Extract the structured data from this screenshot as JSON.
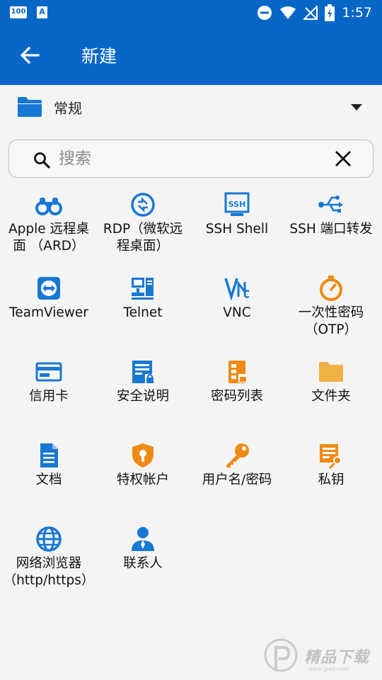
{
  "status_bar": {
    "left_badge_1": "100",
    "left_badge_2": "A",
    "time": "1:57"
  },
  "app_bar": {
    "title": "新建",
    "back_icon": "arrow-left-icon"
  },
  "folder": {
    "label": "常规",
    "icon": "folder-icon"
  },
  "search": {
    "placeholder": "搜索",
    "value": ""
  },
  "items": [
    {
      "label": "Apple 远程桌面 （ARD）",
      "icon": "binoculars-icon",
      "color": "#1778d4"
    },
    {
      "label": "RDP（微软远程桌面）",
      "icon": "remote-desktop-icon",
      "color": "#1778d4"
    },
    {
      "label": "SSH Shell",
      "icon": "ssh-icon",
      "color": "#1778d4"
    },
    {
      "label": "SSH 端口转发",
      "icon": "usb-fork-icon",
      "color": "#1778d4"
    },
    {
      "label": "TeamViewer",
      "icon": "teamviewer-icon",
      "color": "#1778d4"
    },
    {
      "label": "Telnet",
      "icon": "telnet-icon",
      "color": "#1778d4"
    },
    {
      "label": "VNC",
      "icon": "vnc-icon",
      "color": "#1778d4"
    },
    {
      "label": "一次性密码（OTP）",
      "icon": "stopwatch-icon",
      "color": "#ef8a14"
    },
    {
      "label": "信用卡",
      "icon": "credit-card-icon",
      "color": "#1778d4"
    },
    {
      "label": "安全说明",
      "icon": "secure-note-icon",
      "color": "#1778d4"
    },
    {
      "label": "密码列表",
      "icon": "password-list-icon",
      "color": "#ef8a14"
    },
    {
      "label": "文件夹",
      "icon": "folder-icon",
      "color": "#f2b243"
    },
    {
      "label": "文档",
      "icon": "document-icon",
      "color": "#1778d4"
    },
    {
      "label": "特权帐户",
      "icon": "shield-lock-icon",
      "color": "#ef8a14"
    },
    {
      "label": "用户名/密码",
      "icon": "key-icon",
      "color": "#ef8a14"
    },
    {
      "label": "私钥",
      "icon": "private-key-icon",
      "color": "#ef8a14"
    },
    {
      "label": "网络浏览器（http/https）",
      "icon": "globe-icon",
      "color": "#1778d4"
    },
    {
      "label": "联系人",
      "icon": "contact-person-icon",
      "color": "#1778d4"
    }
  ],
  "watermark": {
    "text": "精品下载",
    "sub": "www.jpxz.com"
  }
}
